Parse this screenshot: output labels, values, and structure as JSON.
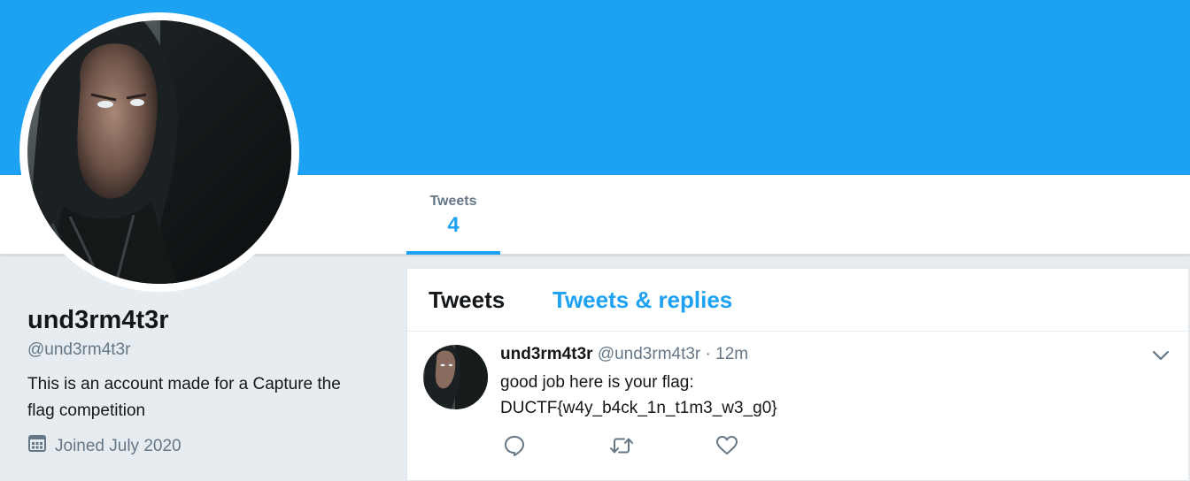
{
  "profile": {
    "name": "und3rm4t3r",
    "handle": "@und3rm4t3r",
    "bio": "This is an account made for a Capture the flag competition",
    "joined": "Joined July 2020"
  },
  "stats": {
    "tweets_label": "Tweets",
    "tweets_count": "4"
  },
  "timeline": {
    "tabs": [
      {
        "label": "Tweets",
        "active": true
      },
      {
        "label": "Tweets & replies",
        "active": false
      }
    ]
  },
  "tweet": {
    "name": "und3rm4t3r",
    "handle": "@und3rm4t3r",
    "separator": "·",
    "time": "12m",
    "lines": [
      "good job here is your flag:",
      "DUCTF{w4y_b4ck_1n_t1m3_w3_g0}"
    ]
  },
  "colors": {
    "accent": "#1da1f2",
    "muted_text": "#657786",
    "page_background": "#e6ecf0"
  },
  "icons": {
    "calendar": "calendar-icon",
    "reply": "reply-icon",
    "retweet": "retweet-icon",
    "like": "heart-icon",
    "menu": "chevron-down-icon"
  }
}
